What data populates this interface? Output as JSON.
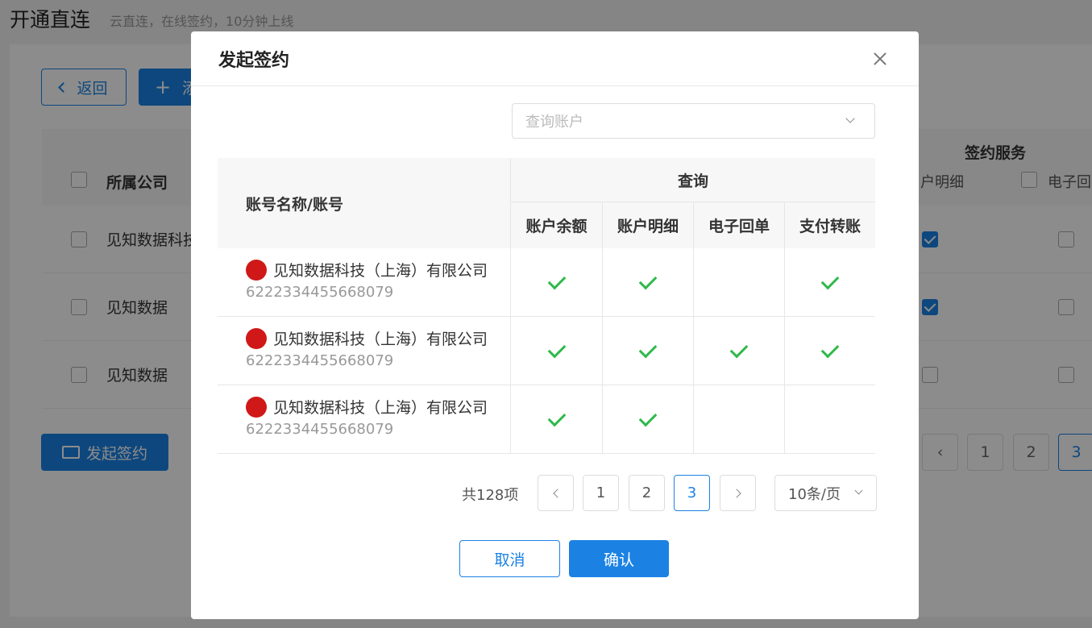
{
  "background": {
    "title": "开通直连",
    "subtitle": "云直连，在线签约，10分钟上线",
    "back_label": "返回",
    "add_label": "添",
    "table_header_company": "所属公司",
    "table_header_service": "签约服务",
    "table_header_detail": "户明细",
    "table_header_receipt": "电子回",
    "rows": [
      {
        "name": "见知数据科技",
        "detail_checked": true,
        "receipt_checked": false
      },
      {
        "name": "见知数据",
        "detail_checked": true,
        "receipt_checked": false
      },
      {
        "name": "见知数据",
        "detail_checked": false,
        "receipt_checked": false
      }
    ],
    "sign_label": "发起签约",
    "pager": [
      "‹",
      "1",
      "2",
      "3"
    ]
  },
  "modal": {
    "title": "发起签约",
    "search": {
      "placeholder": "查询账户"
    },
    "table": {
      "col_account": "账号名称/账号",
      "group_query": "查询",
      "sub_cols": [
        "账户余额",
        "账户明细",
        "电子回单",
        "支付转账"
      ],
      "rows": [
        {
          "name": "见知数据科技（上海）有限公司",
          "account_no": "6222334455668079",
          "checks": [
            true,
            true,
            false,
            true
          ]
        },
        {
          "name": "见知数据科技（上海）有限公司",
          "account_no": "6222334455668079",
          "checks": [
            true,
            true,
            true,
            true
          ]
        },
        {
          "name": "见知数据科技（上海）有限公司",
          "account_no": "6222334455668079",
          "checks": [
            true,
            true,
            false,
            false
          ]
        }
      ]
    },
    "pagination": {
      "total_label": "共128项",
      "pages": [
        "1",
        "2",
        "3"
      ],
      "current": "3",
      "page_size": "10条/页"
    },
    "cancel_label": "取消",
    "confirm_label": "确认"
  },
  "colors": {
    "accent": "#1b82e3",
    "check": "#2fb94a",
    "bank_icon": "#d01818"
  }
}
